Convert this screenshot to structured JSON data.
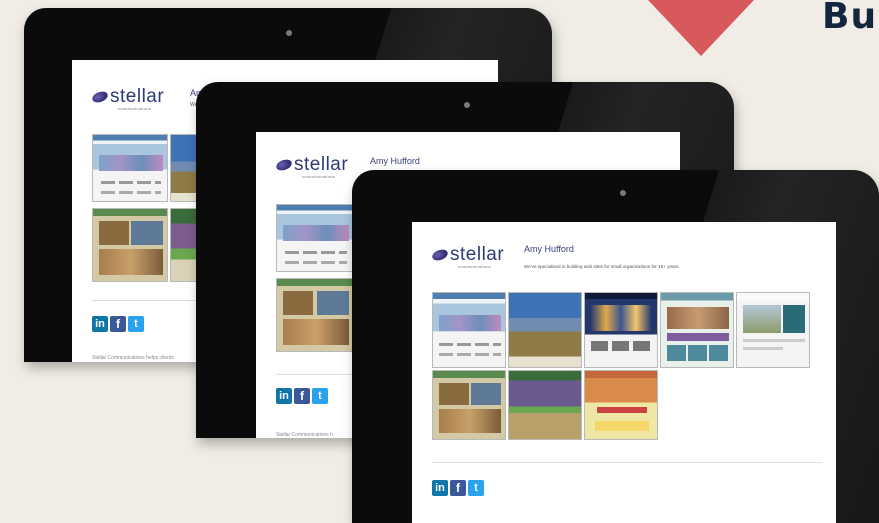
{
  "header": {
    "title_fragment": "Bu"
  },
  "brand": {
    "wordmark": "stellar",
    "subtext": "communications"
  },
  "profile": {
    "name": "Amy Hufford",
    "name_partial": "Am",
    "tagline": "We've specialized in building web sites for small organizations for 15+ years.",
    "tagline_partial": "We"
  },
  "social": {
    "linkedin": "in",
    "facebook": "f",
    "twitter": "t"
  },
  "footer": {
    "text_back": "Stellar Communications helps clients",
    "text_mid": "Stellar Communications h"
  },
  "colors": {
    "arrow": "#d8595b",
    "heading": "#14253e",
    "brand": "#2e3a77",
    "linkedin": "#0e76a8",
    "facebook": "#3b5998",
    "twitter": "#2aa3ef"
  },
  "icons": [
    "logo-mark-icon",
    "linkedin-icon",
    "facebook-icon",
    "twitter-icon",
    "down-arrow-icon"
  ]
}
